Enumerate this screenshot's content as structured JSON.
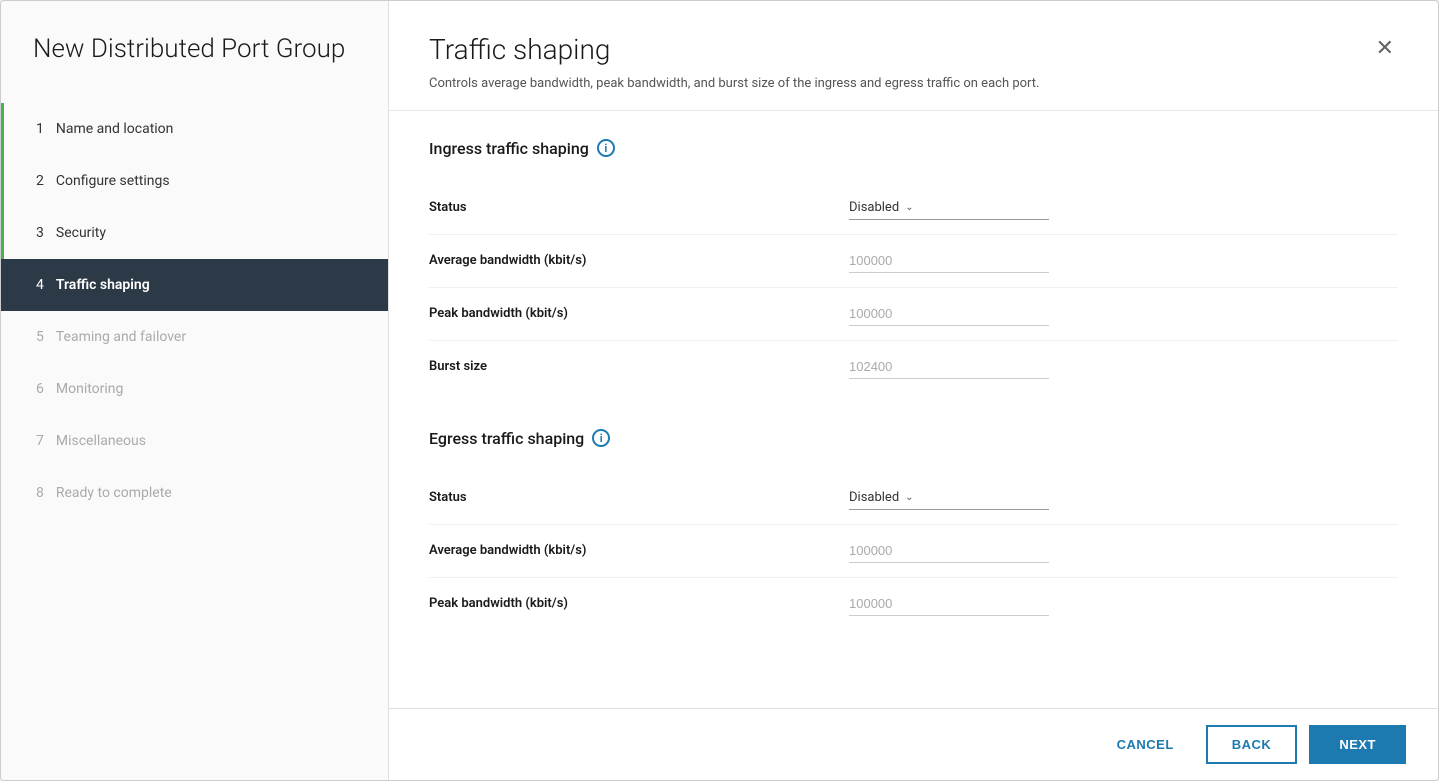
{
  "dialog": {
    "title": "New Distributed Port Group"
  },
  "sidebar": {
    "steps": [
      {
        "num": "1",
        "label": "Name and location",
        "state": "completed"
      },
      {
        "num": "2",
        "label": "Configure settings",
        "state": "completed"
      },
      {
        "num": "3",
        "label": "Security",
        "state": "completed"
      },
      {
        "num": "4",
        "label": "Traffic shaping",
        "state": "active"
      },
      {
        "num": "5",
        "label": "Teaming and failover",
        "state": "disabled"
      },
      {
        "num": "6",
        "label": "Monitoring",
        "state": "disabled"
      },
      {
        "num": "7",
        "label": "Miscellaneous",
        "state": "disabled"
      },
      {
        "num": "8",
        "label": "Ready to complete",
        "state": "disabled"
      }
    ]
  },
  "main": {
    "title": "Traffic shaping",
    "subtitle": "Controls average bandwidth, peak bandwidth, and burst size of the ingress and egress traffic on each port.",
    "ingress": {
      "section_title": "Ingress traffic shaping",
      "fields": [
        {
          "label": "Status",
          "type": "select",
          "value": "Disabled"
        },
        {
          "label": "Average bandwidth (kbit/s)",
          "type": "input",
          "placeholder": "100000"
        },
        {
          "label": "Peak bandwidth (kbit/s)",
          "type": "input",
          "placeholder": "100000"
        },
        {
          "label": "Burst size",
          "type": "input",
          "placeholder": "102400"
        }
      ]
    },
    "egress": {
      "section_title": "Egress traffic shaping",
      "fields": [
        {
          "label": "Status",
          "type": "select",
          "value": "Disabled"
        },
        {
          "label": "Average bandwidth (kbit/s)",
          "type": "input",
          "placeholder": "100000"
        },
        {
          "label": "Peak bandwidth (kbit/s)",
          "type": "input",
          "placeholder": "100000"
        }
      ]
    }
  },
  "footer": {
    "cancel_label": "CANCEL",
    "back_label": "BACK",
    "next_label": "NEXT"
  },
  "icons": {
    "close": "✕",
    "chevron_down": "∨",
    "info": "i"
  }
}
